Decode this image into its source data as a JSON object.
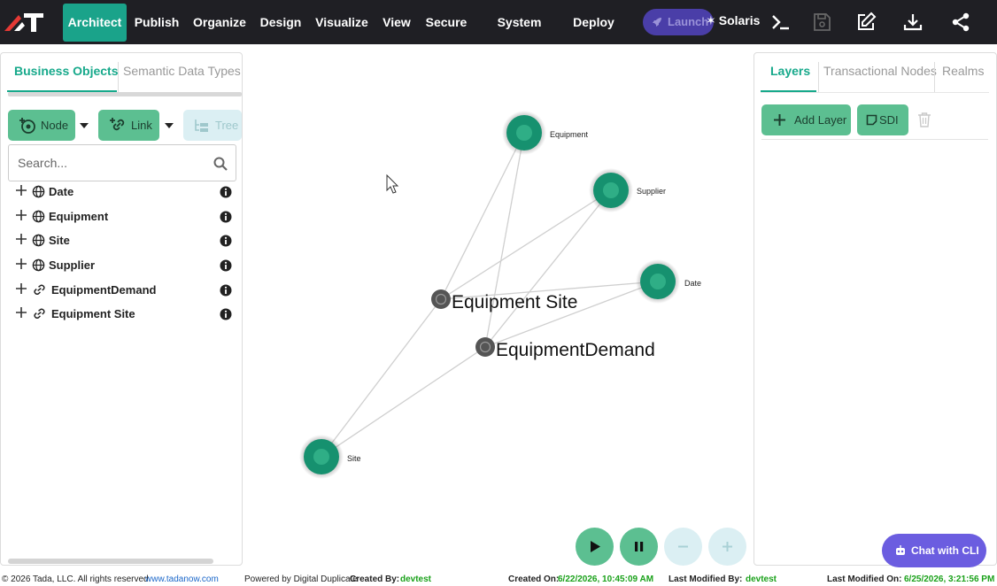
{
  "topbar": {
    "nav": [
      {
        "label": "Architect",
        "active": true
      },
      {
        "label": "Publish"
      },
      {
        "label": "Organize"
      },
      {
        "label": "Design"
      },
      {
        "label": "Visualize"
      },
      {
        "label": "View"
      },
      {
        "label": "Secure"
      },
      {
        "label": "System Check"
      },
      {
        "label": "Deploy"
      }
    ],
    "launch_label": "Launch",
    "solaris_label": "Solaris",
    "icons": [
      "logo-icon",
      "rocket-icon",
      "sparkle-icon",
      "terminal-icon",
      "save-icon",
      "edit-icon",
      "download-icon",
      "share-icon"
    ]
  },
  "left_panel": {
    "tabs": [
      "Business Objects",
      "Semantic Data Types"
    ],
    "node_button": "Node",
    "link_button": "Link",
    "tree_button": "Tree",
    "search_placeholder": "Search...",
    "tree": [
      {
        "label": "Date",
        "icon": "globe-icon"
      },
      {
        "label": "Equipment",
        "icon": "globe-icon"
      },
      {
        "label": "Site",
        "icon": "globe-icon"
      },
      {
        "label": "Supplier",
        "icon": "globe-icon"
      },
      {
        "label": "EquipmentDemand",
        "icon": "link-icon"
      },
      {
        "label": "Equipment Site",
        "icon": "link-icon"
      }
    ]
  },
  "graph": {
    "nodes": [
      {
        "label": "Equipment",
        "kind": "entity"
      },
      {
        "label": "Supplier",
        "kind": "entity"
      },
      {
        "label": "Date",
        "kind": "entity"
      },
      {
        "label": "Site",
        "kind": "entity"
      },
      {
        "label": "Equipment Site",
        "kind": "relation"
      },
      {
        "label": "EquipmentDemand",
        "kind": "relation"
      }
    ]
  },
  "right_panel": {
    "tabs": [
      "Layers",
      "Transactional Nodes",
      "Realms"
    ],
    "add_layer": "Add Layer",
    "sdi": "SDI"
  },
  "chat_label": "Chat with CLI",
  "footer": {
    "copyright": "© 2026 Tada, LLC. All rights reserved.",
    "site": "www.tadanow.com",
    "powered": "Powered by Digital Duplicate",
    "created_by_label": "Created By:",
    "created_by": "devtest",
    "created_on_label": "Created On:",
    "created_on": "6/22/2026, 10:45:09 AM",
    "modified_by_label": "Last Modified By:",
    "modified_by": "devtest",
    "modified_on_label": "Last Modified On:",
    "modified_on": "6/25/2026, 3:21:56 PM"
  },
  "colors": {
    "accent": "#17a98b",
    "button": "#5cbf91",
    "topbar": "#1f1f24",
    "chat": "#6b5de0"
  }
}
